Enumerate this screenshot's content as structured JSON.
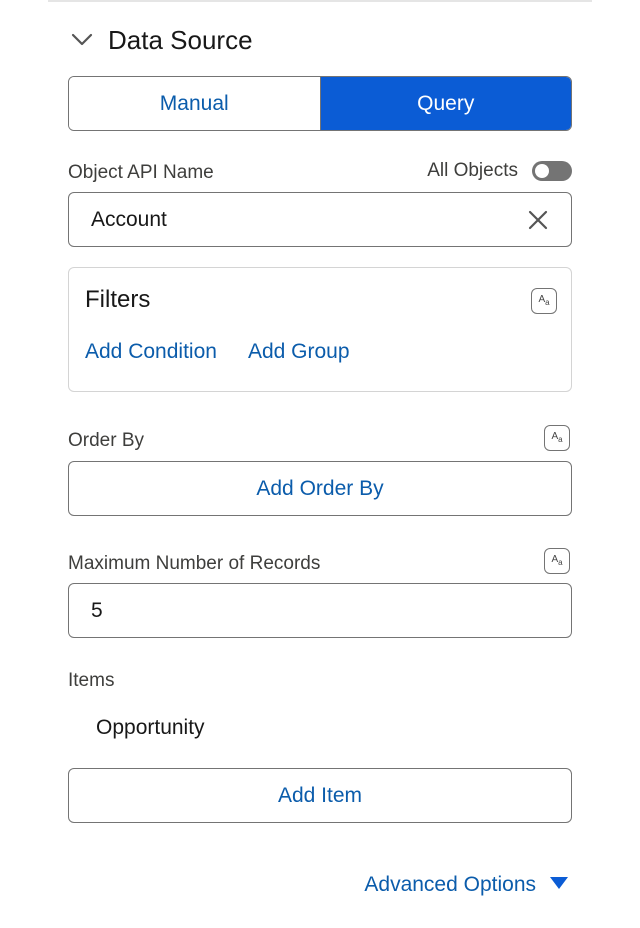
{
  "section": {
    "title": "Data Source",
    "icon": "chevron-down-icon"
  },
  "mode": {
    "manual_label": "Manual",
    "query_label": "Query",
    "selected": "Query"
  },
  "object": {
    "label": "Object API Name",
    "all_objects_label": "All Objects",
    "all_objects_on": false,
    "value": "Account"
  },
  "filters": {
    "title": "Filters",
    "add_condition": "Add Condition",
    "add_group": "Add Group"
  },
  "order_by": {
    "label": "Order By",
    "button": "Add Order By"
  },
  "max_records": {
    "label": "Maximum Number of Records",
    "value": "5"
  },
  "items": {
    "label": "Items",
    "list": [
      "Opportunity"
    ],
    "add_button": "Add Item"
  },
  "advanced": {
    "label": "Advanced Options",
    "icon": "triangle-down-icon"
  },
  "colors": {
    "accent": "#0b5cd5",
    "link": "#0b5cab",
    "border": "#747474"
  }
}
